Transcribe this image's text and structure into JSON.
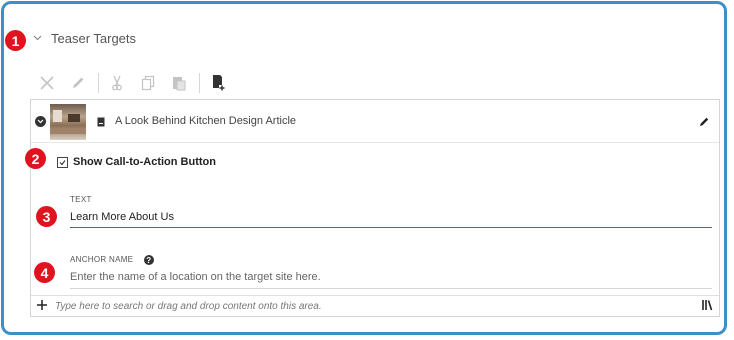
{
  "section": {
    "title": "Teaser Targets"
  },
  "markers": [
    "1",
    "2",
    "3",
    "4"
  ],
  "toolbar": {
    "buttons": [
      {
        "icon": "close-icon",
        "enabled": false
      },
      {
        "icon": "pencil-icon",
        "enabled": false
      },
      {
        "icon": "scissors-icon",
        "enabled": false
      },
      {
        "icon": "copy-icon",
        "enabled": false
      },
      {
        "icon": "paste-icon",
        "enabled": false
      },
      {
        "icon": "new-document-icon",
        "enabled": true
      }
    ]
  },
  "item": {
    "title": "A Look Behind Kitchen Design Article",
    "icon": "article-document-icon"
  },
  "cta": {
    "label": "Show Call-to-Action Button",
    "checked": true
  },
  "text_field": {
    "label": "TEXT",
    "value": "Learn More About Us"
  },
  "anchor_field": {
    "label": "ANCHOR NAME",
    "placeholder": "Enter the name of a location on the target site here."
  },
  "search": {
    "placeholder": "Type here to search or drag and drop content onto this area."
  },
  "colors": {
    "frame": "#3e8fc8",
    "marker": "#e0141e",
    "active_underline": "#2a6fb0"
  }
}
